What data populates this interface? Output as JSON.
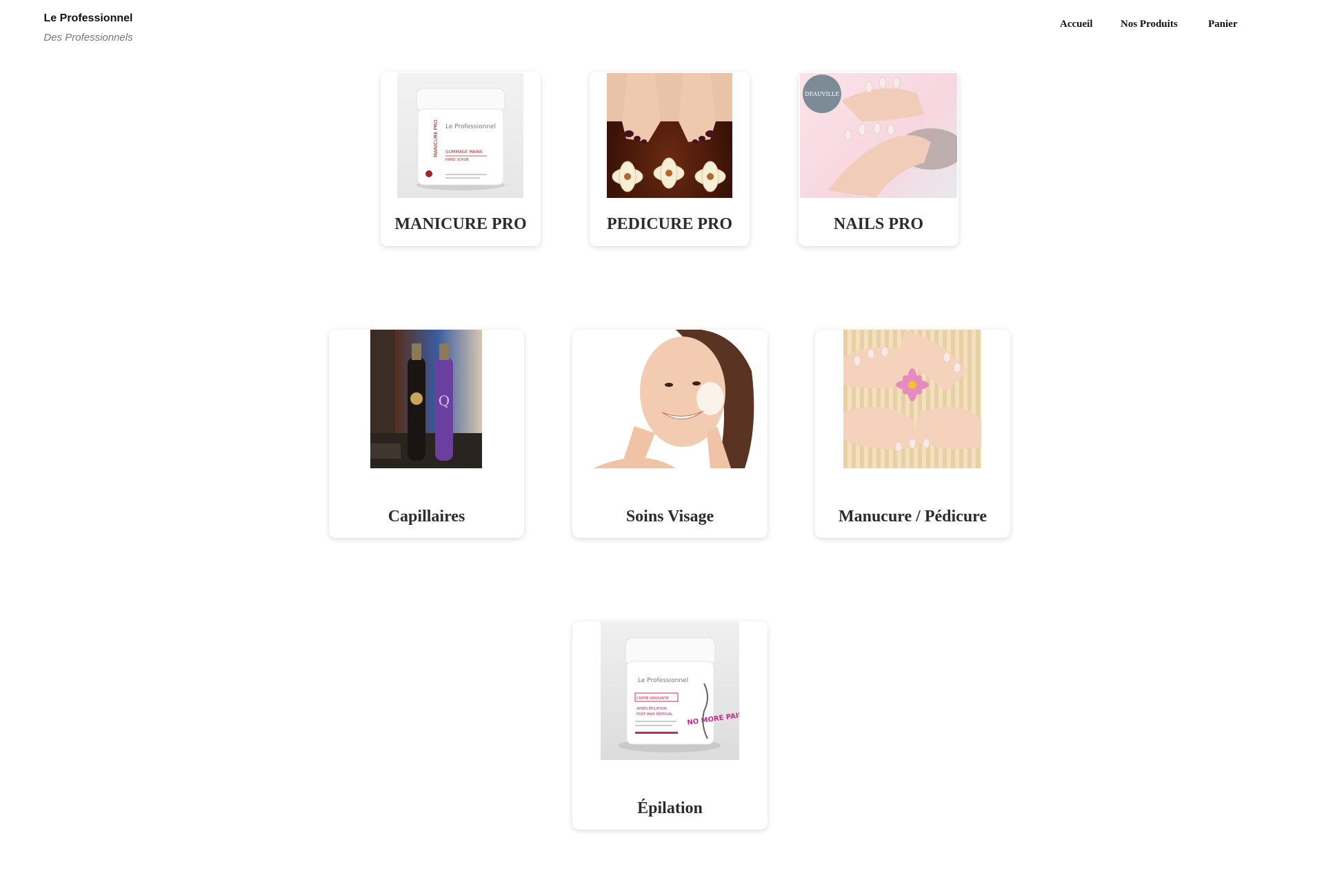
{
  "header": {
    "brand_name": "Le Professionnel",
    "brand_tagline": "Des Professionnels",
    "nav": [
      "Accueil",
      "Nos Produits",
      "Panier"
    ]
  },
  "categories": [
    {
      "title": "MANICURE PRO",
      "image": "hand-scrub-jar"
    },
    {
      "title": "PEDICURE PRO",
      "image": "feet-with-flowers"
    },
    {
      "title": "NAILS PRO",
      "image": "manicured-hands"
    },
    {
      "title": "Capillaires",
      "image": "hair-product-bottles"
    },
    {
      "title": "Soins Visage",
      "image": "woman-face-cream"
    },
    {
      "title": "Manucure / Pédicure",
      "image": "hands-and-feet-flower"
    },
    {
      "title": "Épilation",
      "image": "soothing-cream-jar"
    }
  ],
  "product_labels": {
    "jar1_brand": "Le Professionnel",
    "jar1_side": "MANICURE PRO",
    "jar1_line1": "GOMMAGE MAINS",
    "jar1_line2": "HAND SCRUB",
    "nails_badge": "DEAUVILLE",
    "jar2_brand": "Le Professionnel",
    "jar2_line1": "CRÈME APAISANTE",
    "jar2_line2": "APRÈS ÉPILATION",
    "jar2_line3": "POST HAIR REMOVAL",
    "jar2_slogan": "NO MORE PAIN"
  }
}
